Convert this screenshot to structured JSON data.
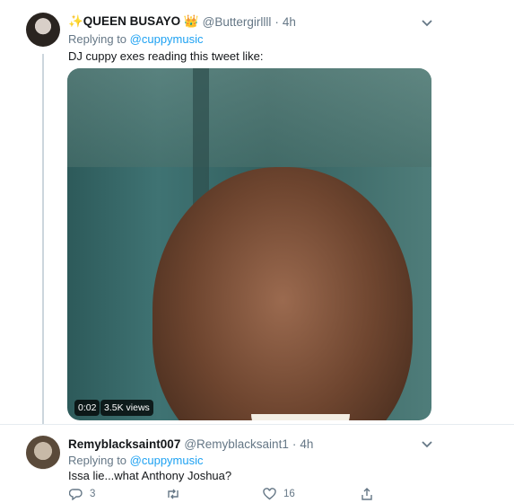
{
  "tweet1": {
    "name": "✨QUEEN BUSAYO 👑",
    "handle": "@Buttergirllll",
    "dot": "·",
    "time": "4h",
    "replying_prefix": "Replying to ",
    "replying_to": "@cuppymusic",
    "text": "DJ cuppy exes reading this tweet like:",
    "video": {
      "duration": "0:02",
      "views": "3.5K views"
    }
  },
  "tweet2": {
    "name": "Remyblacksaint007",
    "handle": "@Remyblacksaint1",
    "dot": "·",
    "time": "4h",
    "replying_prefix": "Replying to ",
    "replying_to": "@cuppymusic",
    "text": "Issa lie...what Anthony Joshua?",
    "actions": {
      "replies": "3",
      "retweets": "",
      "likes": "16"
    }
  }
}
